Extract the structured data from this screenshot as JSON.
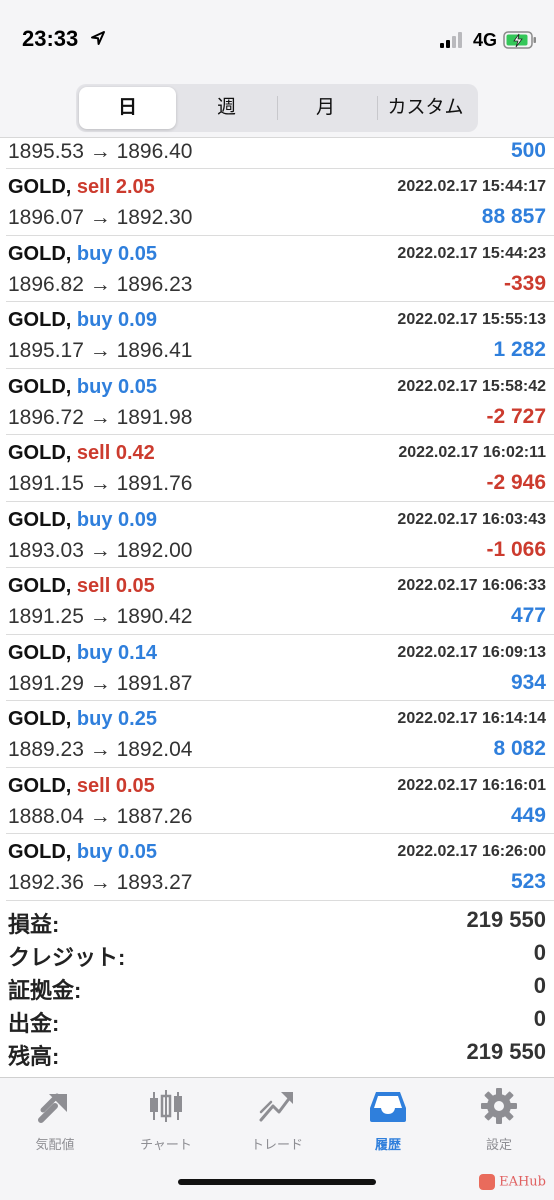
{
  "status_bar": {
    "time": "23:33",
    "network": "4G"
  },
  "segments": [
    {
      "label": "日",
      "active": true
    },
    {
      "label": "週",
      "active": false
    },
    {
      "label": "月",
      "active": false
    },
    {
      "label": "カスタム",
      "active": false
    }
  ],
  "partial_row": {
    "prices": "1895.53 → 1896.40",
    "profit": "500"
  },
  "trades": [
    {
      "symbol": "GOLD,",
      "side": "sell 2.05",
      "type": "sell",
      "time": "2022.02.17 15:44:17",
      "prices": "1896.07 → 1892.30",
      "profit": "88 857",
      "sign": "pos"
    },
    {
      "symbol": "GOLD,",
      "side": "buy 0.05",
      "type": "buy",
      "time": "2022.02.17 15:44:23",
      "prices": "1896.82 → 1896.23",
      "profit": "-339",
      "sign": "neg"
    },
    {
      "symbol": "GOLD,",
      "side": "buy 0.09",
      "type": "buy",
      "time": "2022.02.17 15:55:13",
      "prices": "1895.17 → 1896.41",
      "profit": "1 282",
      "sign": "pos"
    },
    {
      "symbol": "GOLD,",
      "side": "buy 0.05",
      "type": "buy",
      "time": "2022.02.17 15:58:42",
      "prices": "1896.72 → 1891.98",
      "profit": "-2 727",
      "sign": "neg"
    },
    {
      "symbol": "GOLD,",
      "side": "sell 0.42",
      "type": "sell",
      "time": "2022.02.17 16:02:11",
      "prices": "1891.15 → 1891.76",
      "profit": "-2 946",
      "sign": "neg"
    },
    {
      "symbol": "GOLD,",
      "side": "buy 0.09",
      "type": "buy",
      "time": "2022.02.17 16:03:43",
      "prices": "1893.03 → 1892.00",
      "profit": "-1 066",
      "sign": "neg"
    },
    {
      "symbol": "GOLD,",
      "side": "sell 0.05",
      "type": "sell",
      "time": "2022.02.17 16:06:33",
      "prices": "1891.25 → 1890.42",
      "profit": "477",
      "sign": "pos"
    },
    {
      "symbol": "GOLD,",
      "side": "buy 0.14",
      "type": "buy",
      "time": "2022.02.17 16:09:13",
      "prices": "1891.29 → 1891.87",
      "profit": "934",
      "sign": "pos"
    },
    {
      "symbol": "GOLD,",
      "side": "buy 0.25",
      "type": "buy",
      "time": "2022.02.17 16:14:14",
      "prices": "1889.23 → 1892.04",
      "profit": "8 082",
      "sign": "pos"
    },
    {
      "symbol": "GOLD,",
      "side": "sell 0.05",
      "type": "sell",
      "time": "2022.02.17 16:16:01",
      "prices": "1888.04 → 1887.26",
      "profit": "449",
      "sign": "pos"
    },
    {
      "symbol": "GOLD,",
      "side": "buy 0.05",
      "type": "buy",
      "time": "2022.02.17 16:26:00",
      "prices": "1892.36 → 1893.27",
      "profit": "523",
      "sign": "pos"
    }
  ],
  "summary": [
    {
      "label": "損益:",
      "value": "219 550"
    },
    {
      "label": "クレジット:",
      "value": "0"
    },
    {
      "label": "証拠金:",
      "value": "0"
    },
    {
      "label": "出金:",
      "value": "0"
    },
    {
      "label": "残高:",
      "value": "219 550"
    }
  ],
  "tabs": [
    {
      "label": "気配値",
      "icon": "quotes-arrows-icon",
      "active": false
    },
    {
      "label": "チャート",
      "icon": "candlestick-icon",
      "active": false
    },
    {
      "label": "トレード",
      "icon": "trade-line-icon",
      "active": false
    },
    {
      "label": "履歴",
      "icon": "inbox-tray-icon",
      "active": true
    },
    {
      "label": "設定",
      "icon": "gear-icon",
      "active": false
    }
  ],
  "watermark": "EAHub",
  "colors": {
    "buy": "#2f7fdc",
    "sell": "#cc3b2e",
    "accent": "#2f7fdc",
    "inactive": "#8e8e93"
  }
}
